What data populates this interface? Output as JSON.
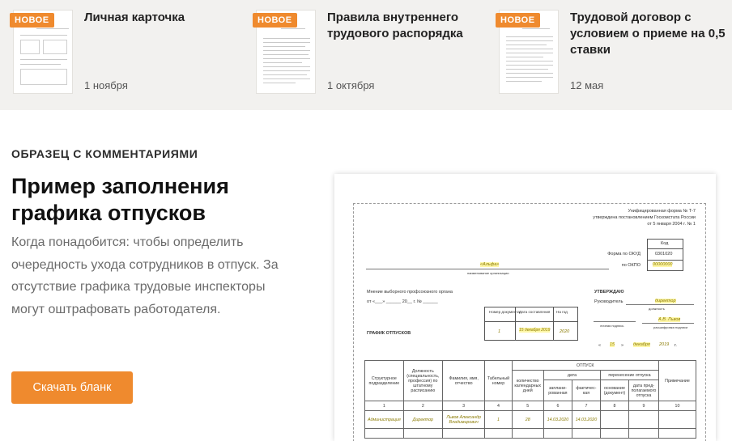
{
  "new_docs": [
    {
      "badge": "НОВОЕ",
      "title": "Личная карточка",
      "date": "1 ноября"
    },
    {
      "badge": "НОВОЕ",
      "title": "Правила внутреннего трудового распорядка",
      "date": "1 октября"
    },
    {
      "badge": "НОВОЕ",
      "title": "Трудовой договор с условием о приеме на 0,5 ставки",
      "date": "12 мая"
    }
  ],
  "section_label": "ОБРАЗЕЦ С КОММЕНТАРИЯМИ",
  "heading": "Пример заполнения графика отпусков",
  "description": "Когда понадобится: чтобы определить очередность ухода сотрудников в отпуск. За отсутствие графика трудовые инспекторы могут оштрафовать работодателя.",
  "download_button": "Скачать бланк",
  "colors": {
    "accent": "#ef8a2e",
    "strip_bg": "#f2f1ef",
    "highlight": "#fff7a8"
  },
  "doc_preview": {
    "form_note": "Унифицированная форма № Т-7",
    "approved_note": "утверждена постановлением Госкомстата России",
    "approved_date": "от 5 января 2004 г. № 1",
    "code_label": "Код",
    "okud_label": "Форма по ОКУД",
    "okud_value": "0301020",
    "okpo_label": "по ОКПО",
    "okpo_value": "00000000",
    "org_name": "«Альфа»",
    "org_caption": "наименование организации",
    "opinion_label": "Мнение выборного профсоюзного органа",
    "approve_label": "УТВЕРЖДАЮ",
    "head_label": "Руководитель",
    "head_position": "директор",
    "position_caption": "должность",
    "doc_number_header": "Номер документа",
    "doc_date_header": "Дата составления",
    "year_header": "На год",
    "doc_number": "1",
    "doc_date": "15 декабря 2019",
    "year": "2020",
    "schedule_title": "ГРАФИК ОТПУСКОВ",
    "signature_caption": "личная подпись",
    "head_name": "А.В. Львов",
    "decode_caption": "расшифровка подписи",
    "approve_day": "15",
    "approve_month": "декабря",
    "approve_year": "2019",
    "table_headers": {
      "dept": "Структурное подразделение",
      "position": "Должность (специальность, профессия) по штатному расписанию",
      "fio": "Фамилия, имя, отчество",
      "tab_no": "Табельный номер",
      "vacation": "ОТПУСК",
      "days": "количество календарных дней",
      "date": "дата",
      "planned": "заплани-рованная",
      "actual": "фактичес-кая",
      "transfer": "перенесение отпуска",
      "basis": "основание (документ)",
      "expected": "дата пред-полагаемого отпуска",
      "note": "Примечание"
    },
    "col_numbers": [
      "1",
      "2",
      "3",
      "4",
      "5",
      "6",
      "7",
      "8",
      "9",
      "10"
    ],
    "row": {
      "dept": "Администрация",
      "position": "Директор",
      "fio": "Львов Александр Владимирович",
      "tab_no": "1",
      "days": "28",
      "planned": "14.03.2020",
      "actual": "14.03.2020"
    }
  }
}
